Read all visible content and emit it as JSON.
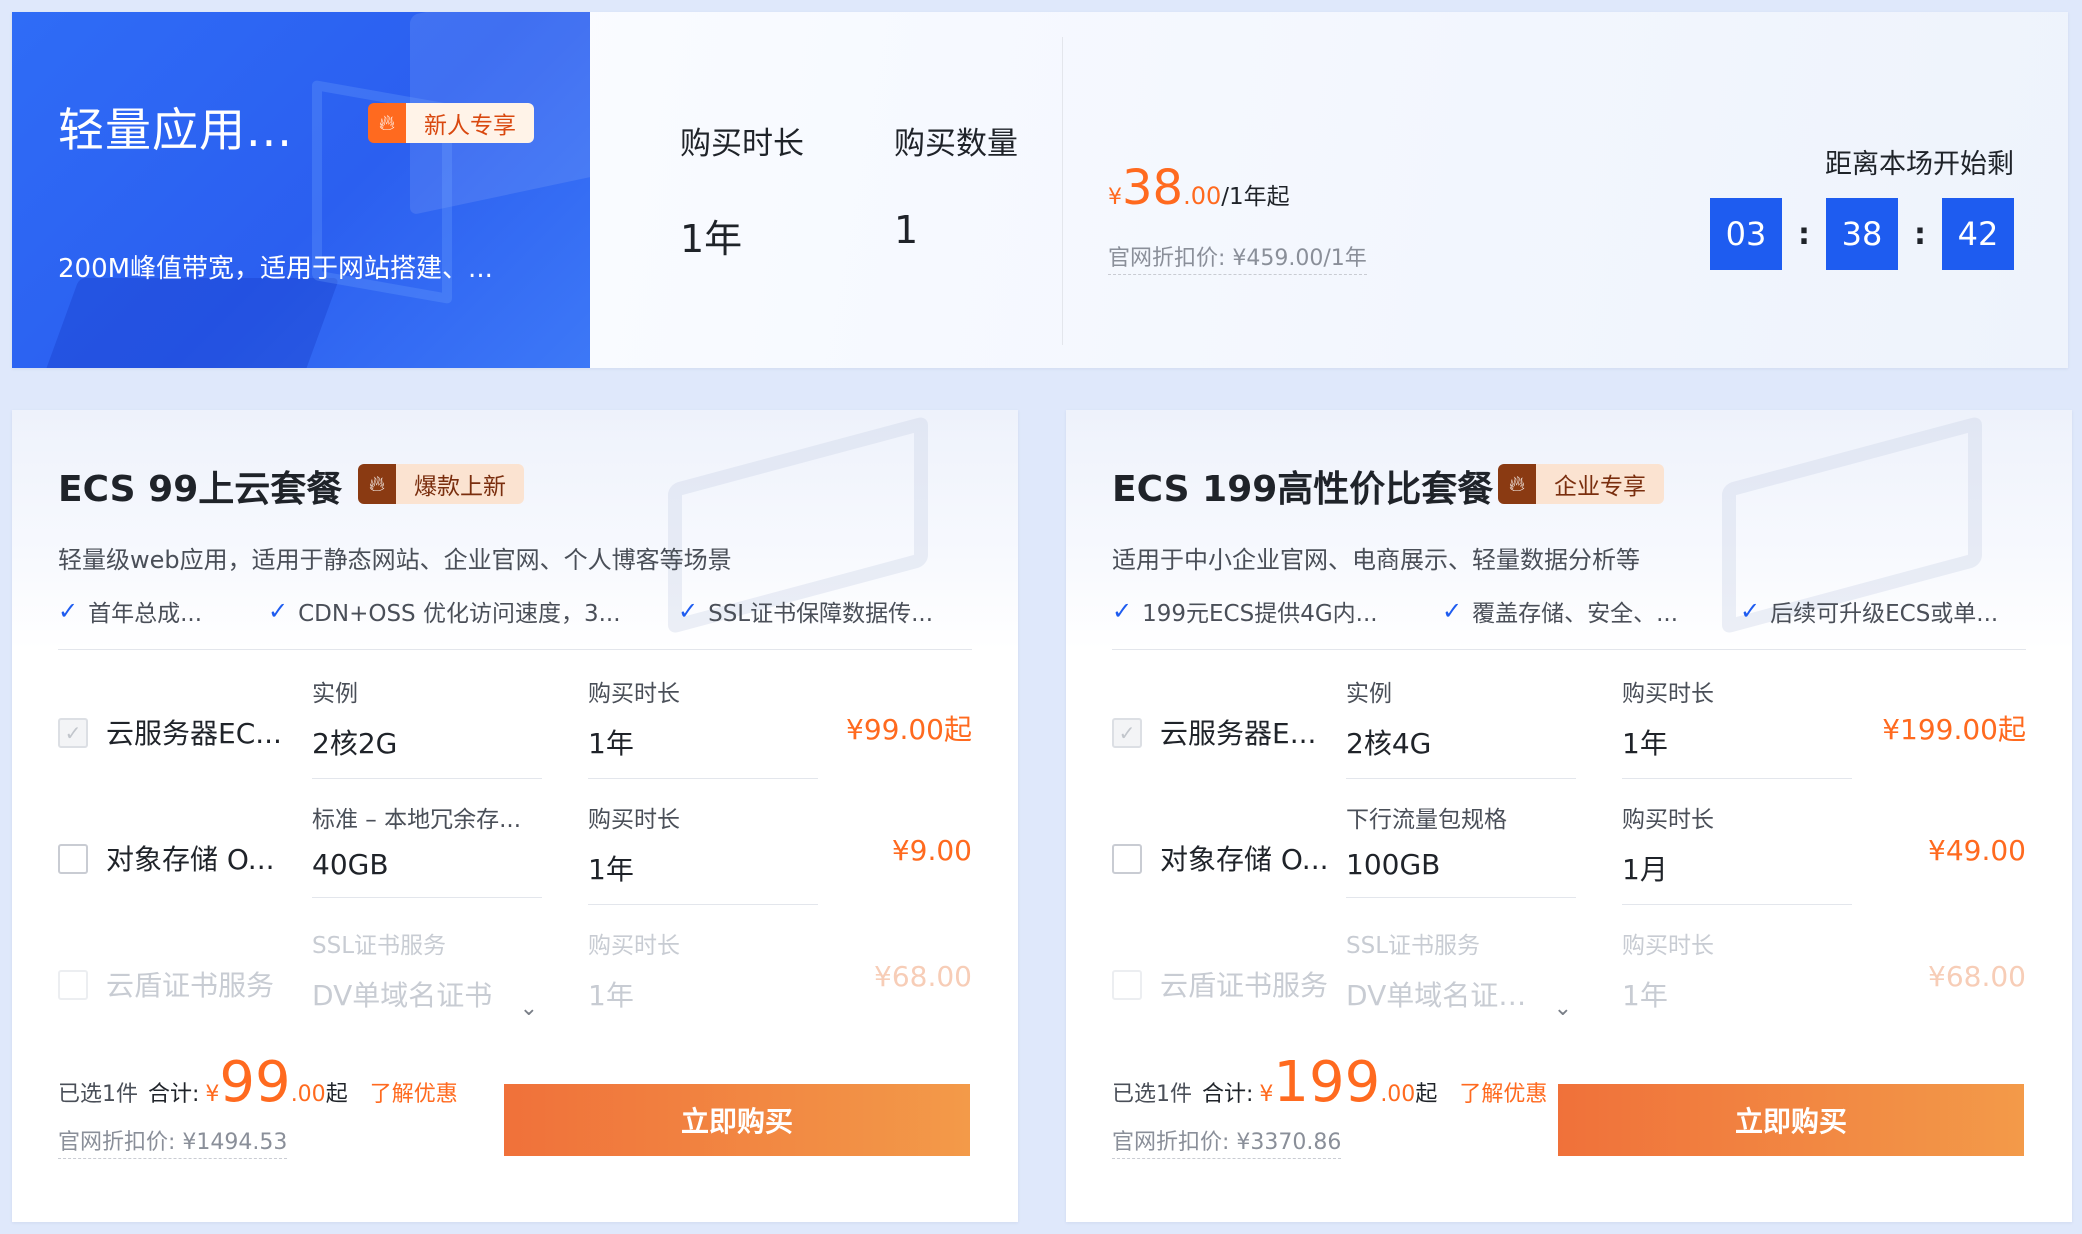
{
  "top": {
    "hero_title": "轻量应用...",
    "badge_label": "新人专享",
    "badge_icon": "fire-icon",
    "hero_desc": "200M峰值带宽，适用于网站搭建、...",
    "duration_label": "购买时长",
    "duration_value": "1年",
    "quantity_label": "购买数量",
    "quantity_value": "1",
    "price_yen": "¥",
    "price_int": "38",
    "price_dec": ".00",
    "price_suffix": "/1年起",
    "orig_price": "官网折扣价: ¥459.00/1年",
    "countdown_label": "距离本场开始剩",
    "countdown_h": "03",
    "countdown_m": "38",
    "countdown_s": "42",
    "countdown_sep": ":"
  },
  "packages": [
    {
      "title": "ECS 99上云套餐",
      "badge": "爆款上新",
      "desc": "轻量级web应用，适用于静态网站、企业官网、个人博客等场景",
      "features": [
        "首年总成...",
        "CDN+OSS 优化访问速度，3...",
        "SSL证书保障数据传..."
      ],
      "rows": [
        {
          "name": "云服务器EC...",
          "c1_label": "实例",
          "c1_value": "2核2G",
          "c2_label": "购买时长",
          "c2_value": "1年",
          "price": "¥99.00起"
        },
        {
          "name": "对象存储 O...",
          "c1_label": "标准 – 本地冗余存...",
          "c1_value": "40GB",
          "c2_label": "购买时长",
          "c2_value": "1年",
          "price": "¥9.00"
        },
        {
          "name": "云盾证书服务",
          "c1_label": "SSL证书服务",
          "c1_value": "DV单域名证书",
          "c2_label": "购买时长",
          "c2_value": "1年",
          "price": "¥68.00"
        }
      ],
      "selected": "已选1件",
      "total_label": "合计:",
      "total_yen": "¥",
      "total_int": "99",
      "total_dec": ".00",
      "total_suffix": "起",
      "learn": "了解优惠",
      "orig": "官网折扣价: ¥1494.53",
      "buy": "立即购买"
    },
    {
      "title": "ECS 199高性价比套餐",
      "badge": "企业专享",
      "desc": "适用于中小企业官网、电商展示、轻量数据分析等",
      "features": [
        "199元ECS提供4G内...",
        "覆盖存储、安全、...",
        "后续可升级ECS或单..."
      ],
      "rows": [
        {
          "name": "云服务器E...",
          "c1_label": "实例",
          "c1_value": "2核4G",
          "c2_label": "购买时长",
          "c2_value": "1年",
          "price": "¥199.00起"
        },
        {
          "name": "对象存储 O...",
          "c1_label": "下行流量包规格",
          "c1_value": "100GB",
          "c2_label": "购买时长",
          "c2_value": "1月",
          "price": "¥49.00"
        },
        {
          "name": "云盾证书服务",
          "c1_label": "SSL证书服务",
          "c1_value": "DV单域名证书...",
          "c2_label": "购买时长",
          "c2_value": "1年",
          "price": "¥68.00"
        }
      ],
      "selected": "已选1件",
      "total_label": "合计:",
      "total_yen": "¥",
      "total_int": "199",
      "total_dec": ".00",
      "total_suffix": "起",
      "learn": "了解优惠",
      "orig": "官网折扣价: ¥3370.86",
      "buy": "立即购买"
    }
  ],
  "colors": {
    "accent": "#1e5cf0",
    "price": "#ff6a1f",
    "buy_start": "#f0713a",
    "buy_end": "#f39a49"
  }
}
